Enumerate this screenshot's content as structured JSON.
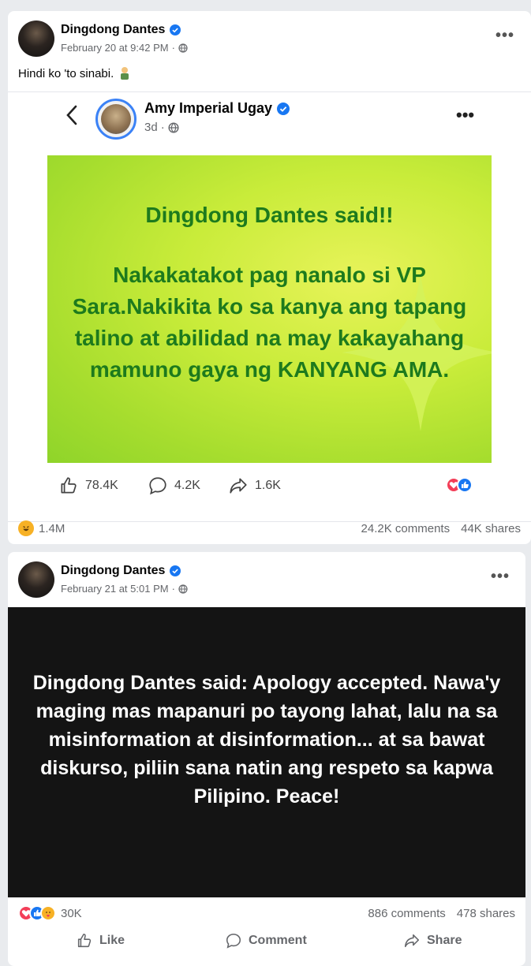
{
  "post1": {
    "author": "Dingdong Dantes",
    "timestamp": "February 20 at 9:42 PM",
    "separator": "·",
    "caption": "Hindi ko 'to sinabi.",
    "shared": {
      "author": "Amy Imperial Ugay",
      "time": "3d",
      "separator": "·",
      "image_title": "Dingdong Dantes said!!",
      "image_body": "Nakakatakot pag nanalo si VP Sara.Nakikita ko sa kanya ang tapang talino at abilidad na may kakayahang mamuno gaya ng KANYANG AMA.",
      "likes": "78.4K",
      "comments": "4.2K",
      "shares": "1.6K"
    },
    "reaction_count": "1.4M",
    "comments_count": "24.2K comments",
    "shares_count": "44K shares"
  },
  "post2": {
    "author": "Dingdong Dantes",
    "timestamp": "February 21 at 5:01 PM",
    "separator": "·",
    "image_text": "Dingdong Dantes said: Apology accepted. Nawa'y maging mas mapanuri po tayong lahat, lalu na sa misinformation at disinformation... at sa bawat diskurso, piliin sana natin ang respeto sa kapwa Pilipino. Peace!",
    "reaction_count": "30K",
    "comments_count": "886 comments",
    "shares_count": "478 shares",
    "actions": {
      "like": "Like",
      "comment": "Comment",
      "share": "Share"
    }
  },
  "colors": {
    "verified": "#1877f2",
    "green_text": "#1d7a1d",
    "muted": "#65676b"
  }
}
